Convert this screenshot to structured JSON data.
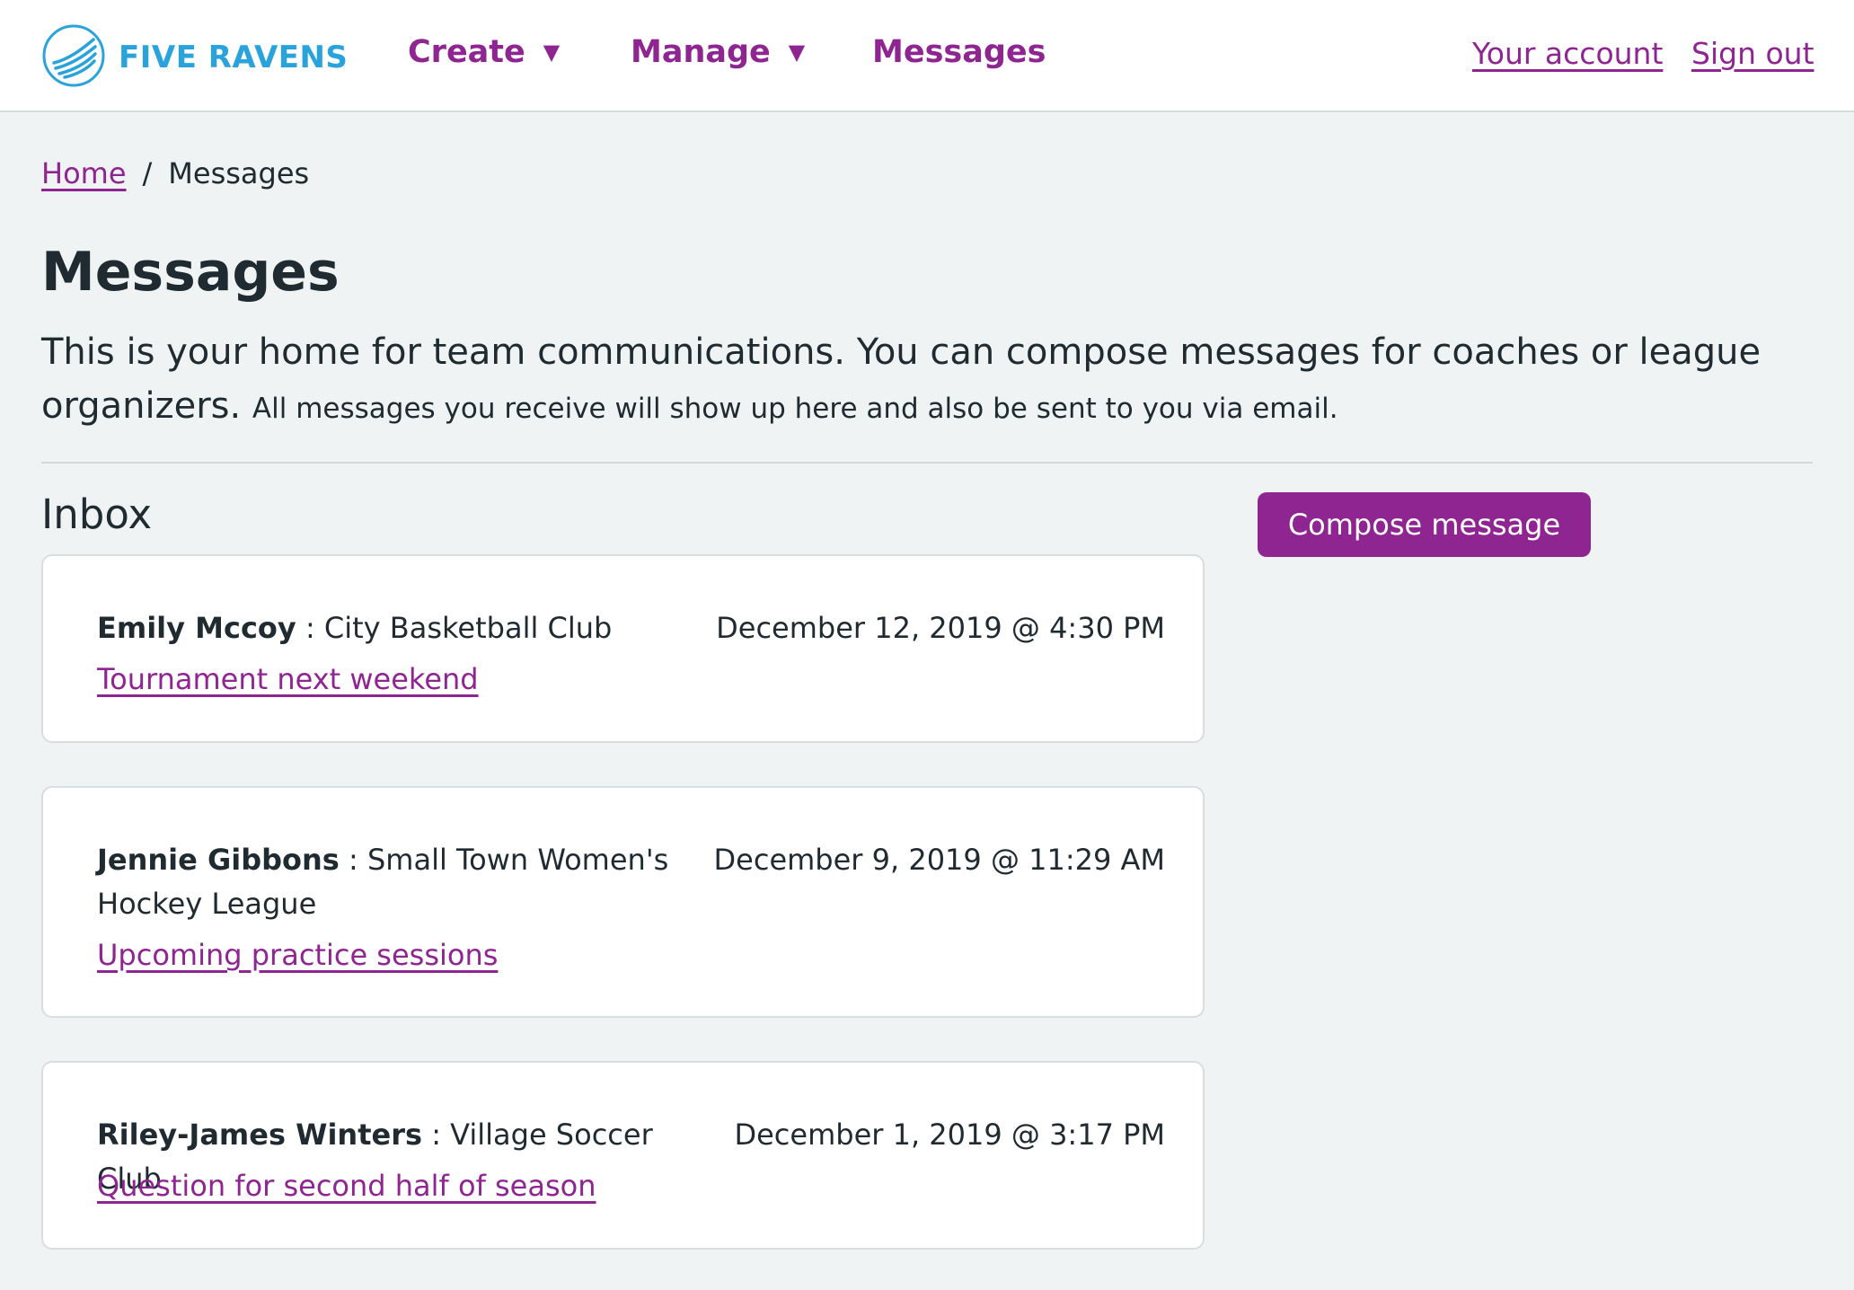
{
  "header": {
    "logo_text": "FIVE RAVENS",
    "logo_icon": "raven-wing-icon",
    "nav": [
      {
        "label": "Create",
        "caret": "▼"
      },
      {
        "label": "Manage",
        "caret": "▼"
      },
      {
        "label": "Messages"
      }
    ],
    "your_account": "Your account",
    "sign_out": "Sign out"
  },
  "breadcrumb": {
    "home": "Home",
    "separator": "/",
    "current": "Messages"
  },
  "page": {
    "title": "Messages",
    "intro_main": "This is your home for team communications. You can compose messages for coaches or league organizers.",
    "intro_small": "All messages you receive will show up here and also be sent to you via email."
  },
  "inbox": {
    "heading": "Inbox",
    "compose_label": "Compose message",
    "messages": [
      {
        "sender": "Emily Mccoy",
        "separator": " : ",
        "organization": "City Basketball Club",
        "date": "December 12, 2019 @ 4:30 PM",
        "subject": "Tournament next weekend"
      },
      {
        "sender": "Jennie Gibbons",
        "separator": " : ",
        "organization": "Small Town Women's Hockey League",
        "date": "December 9, 2019 @ 11:29 AM",
        "subject": "Upcoming practice sessions"
      },
      {
        "sender": "Riley-James Winters",
        "separator": " : ",
        "organization": "Village Soccer Club",
        "date": "December 1, 2019 @ 3:17 PM",
        "subject": "Question for second half of season"
      }
    ]
  },
  "colors": {
    "brand_blue": "#2aa3dc",
    "accent_purple": "#8e2591",
    "background": "#eff3f3",
    "text": "#1f2a31"
  }
}
